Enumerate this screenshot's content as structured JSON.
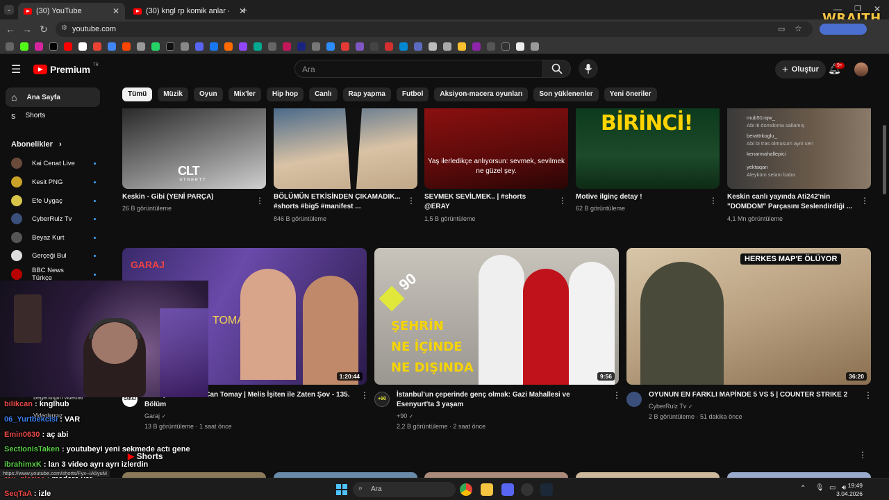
{
  "browser": {
    "tabs": [
      {
        "title": "(30) YouTube",
        "active": true
      },
      {
        "title": "(30) kngl rp komik anlar - YouTube",
        "active": false
      }
    ],
    "url": "youtube.com",
    "overlay_brand": "WRAITH."
  },
  "masthead": {
    "logo": "Premium",
    "logo_tr": "TR",
    "search_placeholder": "Ara",
    "create_label": "Oluştur",
    "notifications": "9+"
  },
  "chips": [
    "Tümü",
    "Müzik",
    "Oyun",
    "Mix'ler",
    "Hip hop",
    "Canlı",
    "Rap yapma",
    "Futbol",
    "Aksiyon-macera oyunları",
    "Son yüklenenler",
    "Yeni öneriler"
  ],
  "sidebar": {
    "home": "Ana Sayfa",
    "shorts": "Shorts",
    "subscriptions_header": "Abonelikler",
    "subscriptions": [
      {
        "name": "Kai Cenat Live",
        "color": "#6a4a3a"
      },
      {
        "name": "Kesit PNG",
        "color": "#c9a227"
      },
      {
        "name": "Efe Uygaç",
        "color": "#d8c44a"
      },
      {
        "name": "CyberRulz Tv",
        "color": "#3a4f7a"
      },
      {
        "name": "Beyaz Kurt",
        "color": "#555555"
      },
      {
        "name": "Gerçeği Bul",
        "color": "#dddddd"
      },
      {
        "name": "BBC News Türkçe",
        "color": "#b80000"
      }
    ],
    "bottom_items": [
      "Beğendiğim videolar",
      "Videolarınız",
      "Shorts"
    ]
  },
  "row1": [
    {
      "title": "Keskin - Gibi (YENİ PARÇA)",
      "meta": "26 B görüntüleme",
      "overlay": "CLT",
      "overlay_sub": "STREETT"
    },
    {
      "title_line1": "BÖLÜMÜN ETKİSİNDEN ÇIKAMADIK...",
      "title_line2": "#shorts #big5 #manifest ...",
      "meta": "846 B görüntüleme"
    },
    {
      "title_line1": "SEVMEK SEVİLMEK.. | #shorts",
      "title_line2": "@ERAY",
      "meta": "1,5 B görüntüleme",
      "caption": "Yaş ilerledikçe anlıyorsun: sevmek, sevilmek ne güzel şey."
    },
    {
      "title": "Motive ilginç detay !",
      "meta": "62 B görüntüleme",
      "overlay": "BİRİNCİ!"
    },
    {
      "title_line1": "Keskin canlı yayında Ati242'nin",
      "title_line2": "\"DOMDOM\" Parçasını Seslendirdiği ...",
      "meta": "4,1 Mn görüntüleme",
      "chat": [
        {
          "user": "mub51nqw_",
          "msg": "Abi iti domdoma sallamış"
        },
        {
          "user": "berattrkoglu_",
          "msg": "Abi bi tras olmusum ayni sen"
        },
        {
          "user": "kenarmahallepici",
          "msg": ""
        },
        {
          "user": "yektaqan",
          "msg": "Aleyküm selam baba"
        }
      ]
    }
  ],
  "row2": [
    {
      "title_line1": "Ali Biçim & Mesut Can Tomay | Melis İşiten ile Zaten Şov - 135.",
      "title_line2": "Bölüm",
      "channel": "Garaj",
      "meta": "13 B görüntüleme · 1 saat önce",
      "duration": "1:20:44",
      "overlay_top": "GARAJ",
      "overlay_mid": "TOMAY",
      "avatar_text": "GARAJ"
    },
    {
      "title_line1": "İstanbul'un çeperinde genç olmak: Gazi Mahallesi ve",
      "title_line2": "Esenyurt'ta 3 yaşam",
      "channel": "+90",
      "meta": "2,2 B görüntüleme · 2 saat önce",
      "duration": "9:56",
      "overlay_lines": [
        "ŞEHRİN",
        "NE İÇİNDE",
        "NE DIŞINDA"
      ],
      "brand": "90"
    },
    {
      "title_line1": "OYUNUN EN FARKLI MAPİNDE 5 VS 5 | COUNTER STRIKE 2",
      "channel": "CyberRulz Tv",
      "meta": "2 B görüntüleme · 51 dakika önce",
      "duration": "36:20",
      "overlay": "HERKES MAP'E ÖLÜYOR"
    }
  ],
  "stream_chat": [
    {
      "user": "bilikcan",
      "msg": ": knglhub",
      "color": "#e84a4a"
    },
    {
      "user": "06_Yurtbekcisi",
      "msg": ": VAR",
      "color": "#3a7de8"
    },
    {
      "user": "Emin0630",
      "msg": ": aç abi",
      "color": "#e84a4a"
    },
    {
      "user": "SectionisTaken",
      "msg": ": youtubeyi yeni sekmede actı gene",
      "color": "#59d046"
    },
    {
      "user": "ibrahimxK",
      "msg": ": lan 3 video ayrı ayrı izlerdin",
      "color": "#59d046"
    },
    {
      "user": "rex_gloriae",
      "msg": ": madara var",
      "color": "#e84a4a"
    },
    {
      "user": "SeqTaA",
      "msg": ": izle",
      "color": "#e84a4a"
    }
  ],
  "status_url": "https://www.youtube.com/shorts/Fyx--iA5yuM",
  "taskbar": {
    "search": "Ara",
    "time": "19:49",
    "date": "3.04.2026"
  }
}
